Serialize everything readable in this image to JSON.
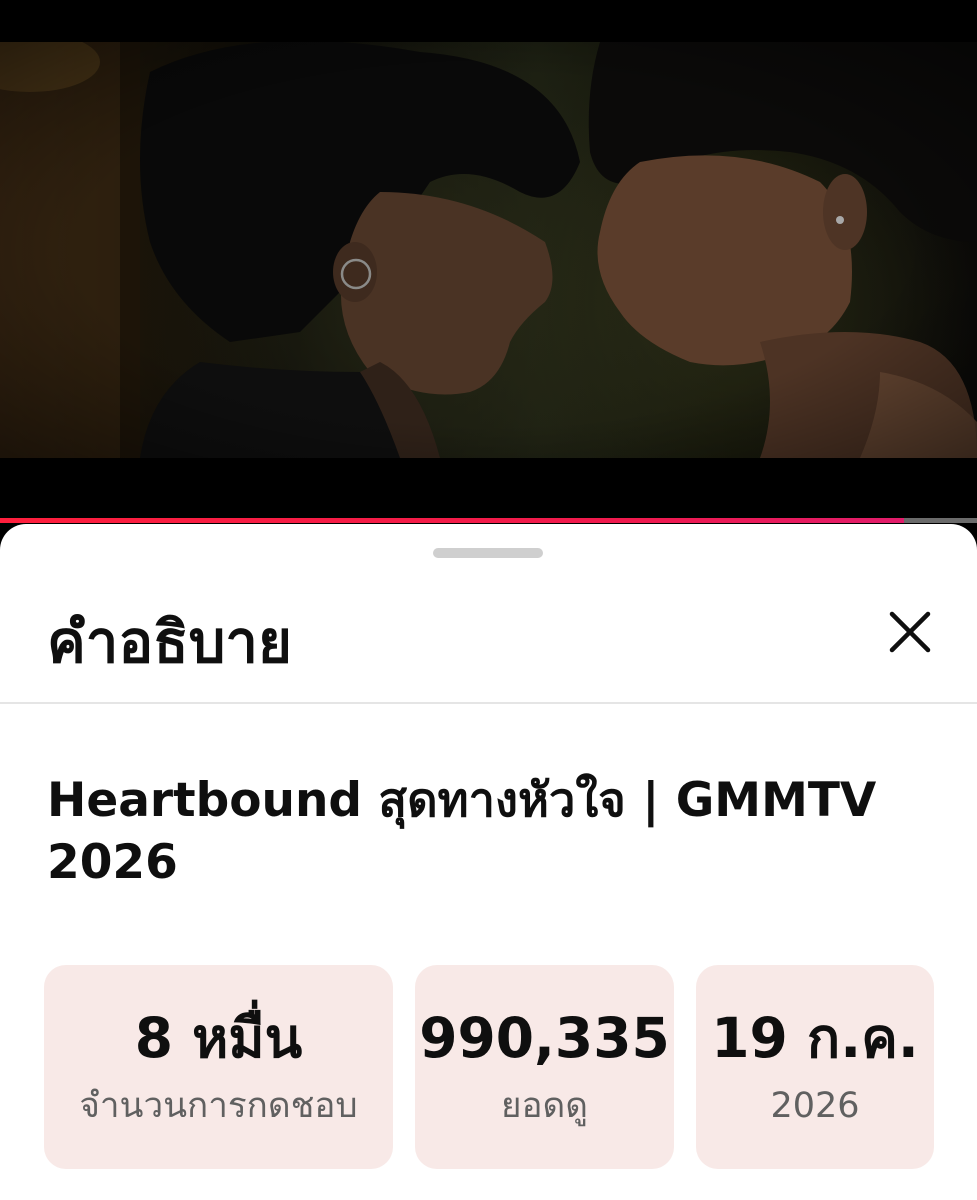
{
  "player": {
    "progress_fraction": 0.925,
    "progress_color": "#ff1f3d",
    "track_color": "#6b6b6b"
  },
  "sheet": {
    "title": "คำอธิบาย",
    "close_icon": "close-icon",
    "handle_icon": "drag-handle"
  },
  "video": {
    "title": "Heartbound สุดทางหัวใจ | GMMTV 2026"
  },
  "stats": {
    "likes": {
      "value": "8 หมื่น",
      "label": "จำนวนการกดชอบ"
    },
    "views": {
      "value": "990,335",
      "label": "ยอดดู"
    },
    "date": {
      "value": "19 ก.ค.",
      "label": "2026"
    }
  },
  "colors": {
    "stat_background": "#f8e9e7",
    "text_primary": "#0f0f0f",
    "text_secondary": "#606060"
  }
}
